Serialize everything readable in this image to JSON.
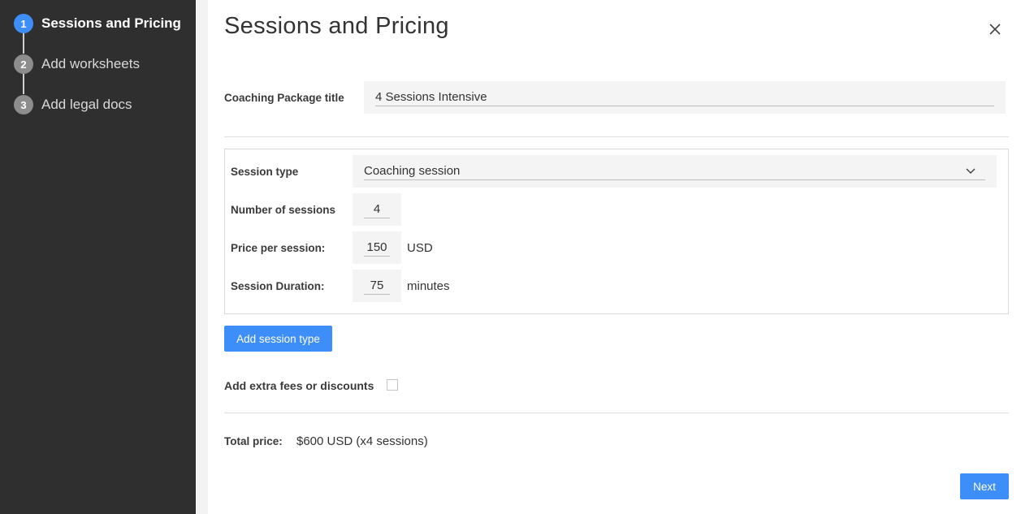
{
  "sidebar": {
    "steps": [
      {
        "number": "1",
        "label": "Sessions and Pricing",
        "active": true
      },
      {
        "number": "2",
        "label": "Add worksheets",
        "active": false
      },
      {
        "number": "3",
        "label": "Add legal docs",
        "active": false
      }
    ]
  },
  "header": {
    "title": "Sessions and Pricing",
    "close_icon": "close-icon"
  },
  "package": {
    "label": "Coaching Package title",
    "value": "4 Sessions Intensive"
  },
  "session": {
    "type_label": "Session type",
    "type_value": "Coaching session",
    "count_label": "Number of sessions",
    "count_value": "4",
    "price_label": "Price per session:",
    "price_value": "150",
    "price_unit": "USD",
    "duration_label": "Session Duration:",
    "duration_value": "75",
    "duration_unit": "minutes"
  },
  "add_session_button": "Add session type",
  "extras": {
    "label": "Add extra fees or discounts",
    "checked": false
  },
  "total": {
    "label": "Total price:",
    "value": "$600 USD (x4 sessions)"
  },
  "next_button": "Next",
  "colors": {
    "accent": "#3d8ef8",
    "sidebar_bg": "#2f2f2f"
  }
}
